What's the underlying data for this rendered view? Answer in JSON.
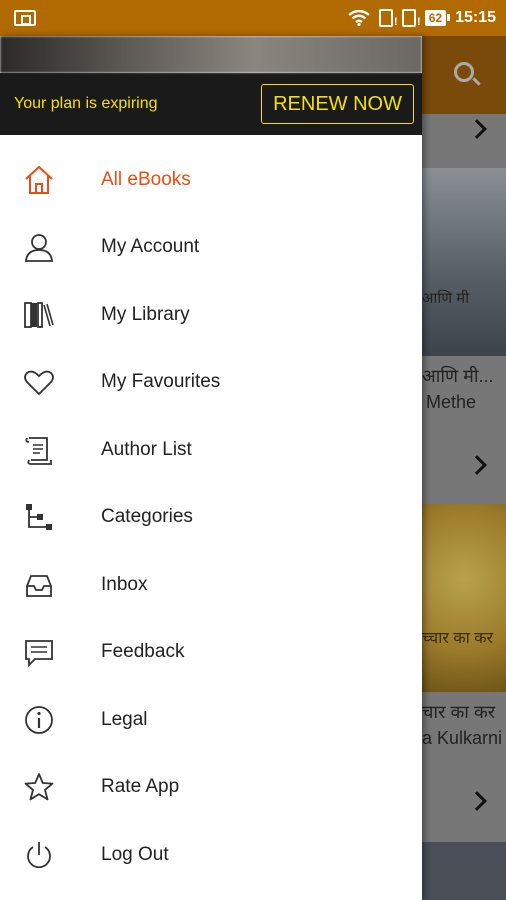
{
  "status_bar": {
    "battery": "62",
    "time": "15:15"
  },
  "plan_banner": {
    "message": "Your plan is expiring",
    "renew_label": "RENEW NOW"
  },
  "menu": {
    "items": [
      {
        "label": "All eBooks",
        "icon": "home-icon",
        "active": true
      },
      {
        "label": "My Account",
        "icon": "user-icon"
      },
      {
        "label": "My Library",
        "icon": "library-icon"
      },
      {
        "label": "My Favourites",
        "icon": "heart-icon"
      },
      {
        "label": "Author List",
        "icon": "scroll-icon"
      },
      {
        "label": "Categories",
        "icon": "tree-icon"
      },
      {
        "label": "Inbox",
        "icon": "inbox-icon"
      },
      {
        "label": "Feedback",
        "icon": "feedback-icon"
      },
      {
        "label": "Legal",
        "icon": "info-icon"
      },
      {
        "label": "Rate App",
        "icon": "star-icon"
      },
      {
        "label": "Log Out",
        "icon": "power-icon"
      }
    ]
  },
  "background": {
    "book1_title_fragment": "आणि मी...",
    "book1_author_fragment": "Methe",
    "book1_cover_text": "आणि मी",
    "book2_title_fragment": "चार का कर",
    "book2_author_fragment": "a Kulkarni",
    "book2_cover_text": "च्चार का कर"
  },
  "colors": {
    "status_bar": "#b06a00",
    "accent": "#e84e12",
    "banner_text": "#f5e000",
    "banner_bg": "#1a1a1a"
  }
}
